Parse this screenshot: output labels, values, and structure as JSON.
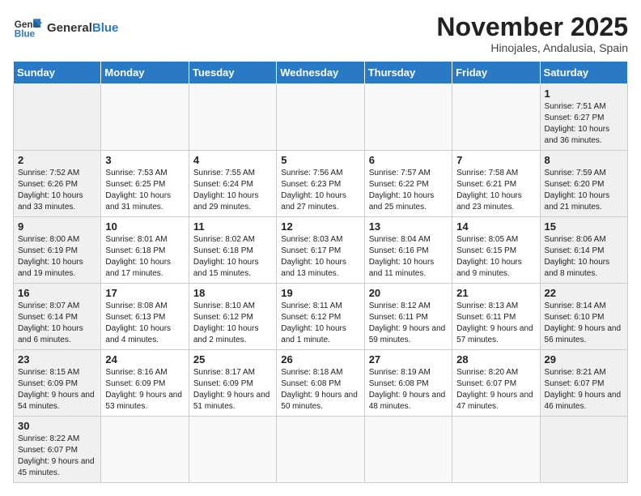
{
  "header": {
    "logo_text_normal": "General",
    "logo_text_bold": "Blue",
    "month_title": "November 2025",
    "subtitle": "Hinojales, Andalusia, Spain"
  },
  "weekdays": [
    "Sunday",
    "Monday",
    "Tuesday",
    "Wednesday",
    "Thursday",
    "Friday",
    "Saturday"
  ],
  "weeks": [
    [
      {
        "day": "",
        "info": ""
      },
      {
        "day": "",
        "info": ""
      },
      {
        "day": "",
        "info": ""
      },
      {
        "day": "",
        "info": ""
      },
      {
        "day": "",
        "info": ""
      },
      {
        "day": "",
        "info": ""
      },
      {
        "day": "1",
        "info": "Sunrise: 7:51 AM\nSunset: 6:27 PM\nDaylight: 10 hours and 36 minutes."
      }
    ],
    [
      {
        "day": "2",
        "info": "Sunrise: 7:52 AM\nSunset: 6:26 PM\nDaylight: 10 hours and 33 minutes."
      },
      {
        "day": "3",
        "info": "Sunrise: 7:53 AM\nSunset: 6:25 PM\nDaylight: 10 hours and 31 minutes."
      },
      {
        "day": "4",
        "info": "Sunrise: 7:55 AM\nSunset: 6:24 PM\nDaylight: 10 hours and 29 minutes."
      },
      {
        "day": "5",
        "info": "Sunrise: 7:56 AM\nSunset: 6:23 PM\nDaylight: 10 hours and 27 minutes."
      },
      {
        "day": "6",
        "info": "Sunrise: 7:57 AM\nSunset: 6:22 PM\nDaylight: 10 hours and 25 minutes."
      },
      {
        "day": "7",
        "info": "Sunrise: 7:58 AM\nSunset: 6:21 PM\nDaylight: 10 hours and 23 minutes."
      },
      {
        "day": "8",
        "info": "Sunrise: 7:59 AM\nSunset: 6:20 PM\nDaylight: 10 hours and 21 minutes."
      }
    ],
    [
      {
        "day": "9",
        "info": "Sunrise: 8:00 AM\nSunset: 6:19 PM\nDaylight: 10 hours and 19 minutes."
      },
      {
        "day": "10",
        "info": "Sunrise: 8:01 AM\nSunset: 6:18 PM\nDaylight: 10 hours and 17 minutes."
      },
      {
        "day": "11",
        "info": "Sunrise: 8:02 AM\nSunset: 6:18 PM\nDaylight: 10 hours and 15 minutes."
      },
      {
        "day": "12",
        "info": "Sunrise: 8:03 AM\nSunset: 6:17 PM\nDaylight: 10 hours and 13 minutes."
      },
      {
        "day": "13",
        "info": "Sunrise: 8:04 AM\nSunset: 6:16 PM\nDaylight: 10 hours and 11 minutes."
      },
      {
        "day": "14",
        "info": "Sunrise: 8:05 AM\nSunset: 6:15 PM\nDaylight: 10 hours and 9 minutes."
      },
      {
        "day": "15",
        "info": "Sunrise: 8:06 AM\nSunset: 6:14 PM\nDaylight: 10 hours and 8 minutes."
      }
    ],
    [
      {
        "day": "16",
        "info": "Sunrise: 8:07 AM\nSunset: 6:14 PM\nDaylight: 10 hours and 6 minutes."
      },
      {
        "day": "17",
        "info": "Sunrise: 8:08 AM\nSunset: 6:13 PM\nDaylight: 10 hours and 4 minutes."
      },
      {
        "day": "18",
        "info": "Sunrise: 8:10 AM\nSunset: 6:12 PM\nDaylight: 10 hours and 2 minutes."
      },
      {
        "day": "19",
        "info": "Sunrise: 8:11 AM\nSunset: 6:12 PM\nDaylight: 10 hours and 1 minute."
      },
      {
        "day": "20",
        "info": "Sunrise: 8:12 AM\nSunset: 6:11 PM\nDaylight: 9 hours and 59 minutes."
      },
      {
        "day": "21",
        "info": "Sunrise: 8:13 AM\nSunset: 6:11 PM\nDaylight: 9 hours and 57 minutes."
      },
      {
        "day": "22",
        "info": "Sunrise: 8:14 AM\nSunset: 6:10 PM\nDaylight: 9 hours and 56 minutes."
      }
    ],
    [
      {
        "day": "23",
        "info": "Sunrise: 8:15 AM\nSunset: 6:09 PM\nDaylight: 9 hours and 54 minutes."
      },
      {
        "day": "24",
        "info": "Sunrise: 8:16 AM\nSunset: 6:09 PM\nDaylight: 9 hours and 53 minutes."
      },
      {
        "day": "25",
        "info": "Sunrise: 8:17 AM\nSunset: 6:09 PM\nDaylight: 9 hours and 51 minutes."
      },
      {
        "day": "26",
        "info": "Sunrise: 8:18 AM\nSunset: 6:08 PM\nDaylight: 9 hours and 50 minutes."
      },
      {
        "day": "27",
        "info": "Sunrise: 8:19 AM\nSunset: 6:08 PM\nDaylight: 9 hours and 48 minutes."
      },
      {
        "day": "28",
        "info": "Sunrise: 8:20 AM\nSunset: 6:07 PM\nDaylight: 9 hours and 47 minutes."
      },
      {
        "day": "29",
        "info": "Sunrise: 8:21 AM\nSunset: 6:07 PM\nDaylight: 9 hours and 46 minutes."
      }
    ],
    [
      {
        "day": "30",
        "info": "Sunrise: 8:22 AM\nSunset: 6:07 PM\nDaylight: 9 hours and 45 minutes."
      },
      {
        "day": "",
        "info": ""
      },
      {
        "day": "",
        "info": ""
      },
      {
        "day": "",
        "info": ""
      },
      {
        "day": "",
        "info": ""
      },
      {
        "day": "",
        "info": ""
      },
      {
        "day": "",
        "info": ""
      }
    ]
  ]
}
